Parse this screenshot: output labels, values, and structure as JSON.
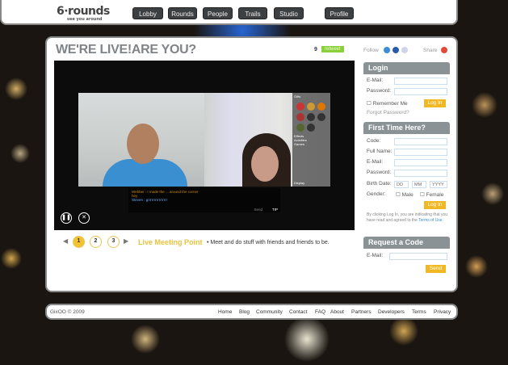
{
  "header": {
    "logo": "6·rounds",
    "tagline": "see you around",
    "nav": [
      "Lobby",
      "Rounds",
      "People",
      "Trails",
      "Studio",
      "Profile"
    ]
  },
  "main": {
    "title": "WE'RE LIVE!ARE YOU?",
    "retweet_count": "9",
    "retweet_label": "retweet",
    "follow_label": "Follow",
    "share_label": "Share",
    "video": {
      "chat_lines": [
        "Webber : I made the ... around the corner",
        "hey",
        "Steven : grrrrrrrrrrrrrrrr"
      ],
      "send_label": "Send",
      "tip_label": "TIP",
      "gifts_label": "Gifts",
      "effects_label": "Effects",
      "activities_label": "Activities",
      "games_label": "Games",
      "display_label": "Display"
    },
    "pager": {
      "pages": [
        "1",
        "2",
        "3"
      ],
      "active": "1"
    },
    "feature_title": "Live Meeting Point",
    "feature_desc": "Meet and do stuff with friends and friends to be."
  },
  "login": {
    "title": "Login",
    "email_label": "E-Mail:",
    "password_label": "Password:",
    "remember_label": "Remember Me",
    "button": "Log In",
    "forgot": "Forgot Password?"
  },
  "signup": {
    "title": "First Time Here?",
    "code_label": "Code:",
    "name_label": "Full Name:",
    "email_label": "E-Mail:",
    "password_label": "Password:",
    "birth_label": "Birth Date:",
    "dd": "DD",
    "mm": "MM",
    "yyyy": "YYYY",
    "gender_label": "Gender:",
    "male": "Male",
    "female": "Female",
    "button": "Log In",
    "terms_text": "By clicking Log In, you are indicating that you have read and agreed to the",
    "terms_link": "Terms of Use."
  },
  "request": {
    "title": "Request a Code",
    "email_label": "E-Mail:",
    "button": "Send"
  },
  "footer": {
    "copyright": "GixOO © 2009",
    "links": [
      "Home",
      "Blog",
      "Community",
      "Contact",
      "FAQ",
      "About",
      "Partners",
      "Developers",
      "Terms",
      "Privacy"
    ]
  },
  "colors": {
    "accent": "#f2b823",
    "retweet": "#8bcf3a",
    "header_gray": "#8a9296"
  }
}
